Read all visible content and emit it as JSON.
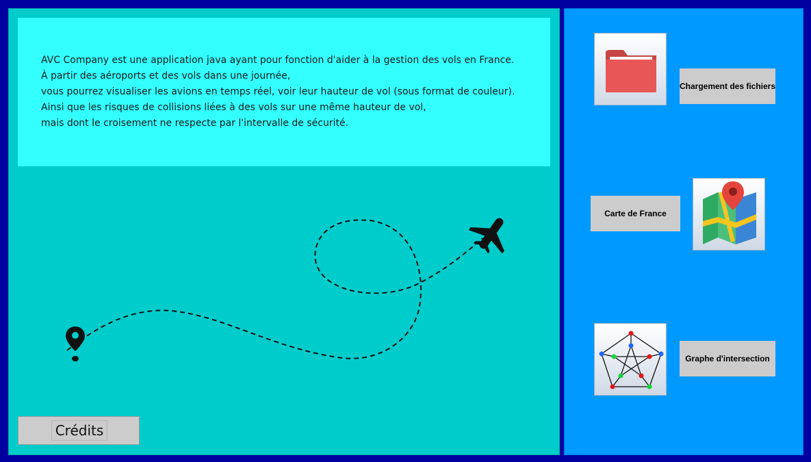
{
  "description": {
    "lines": [
      "AVC Company est une application java ayant pour fonction d'aider à la gestion des vols en France.",
      "À partir des aéroports et des vols dans une journée,",
      "vous pourrez visualiser les avions en temps réel, voir leur hauteur de vol (sous format de couleur).",
      "Ainsi que les risques de collisions liées à des vols sur une même hauteur de vol,",
      "mais dont le croisement ne respecte par l'intervalle de sécurité."
    ]
  },
  "credits": {
    "label": "Crédits"
  },
  "sidebar": {
    "load_files": {
      "label": "Chargement des fichiers",
      "icon": "folder-icon"
    },
    "map_france": {
      "label": "Carte de France",
      "icon": "map-icon"
    },
    "intersection_graph": {
      "label": "Graphe d'intersection",
      "icon": "graph-icon"
    }
  },
  "colors": {
    "frame": "#0000a0",
    "main_panel": "#00cccc",
    "description_box": "#33ffff",
    "side_panel": "#0099ff",
    "button": "#cccccc"
  }
}
